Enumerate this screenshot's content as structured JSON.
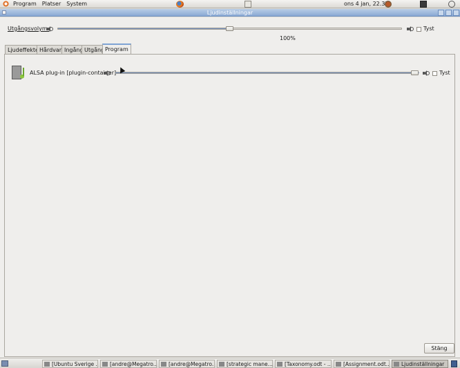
{
  "top_panel": {
    "menus": [
      "Program",
      "Platser",
      "System"
    ],
    "clock": "ons  4 jan, 22.37"
  },
  "window": {
    "title": "Ljudinställningar"
  },
  "output": {
    "label": "Utgångsvolym:",
    "volume_value": 0.5,
    "percent_label": "100%",
    "mute_label": "Tyst"
  },
  "tabs": [
    {
      "label": "Ljudeffekter",
      "active": false
    },
    {
      "label": "Hårdvara",
      "active": false
    },
    {
      "label": "Ingång",
      "active": false
    },
    {
      "label": "Utgång",
      "active": false
    },
    {
      "label": "Program",
      "active": true
    }
  ],
  "applications": [
    {
      "name": "ALSA plug-in [plugin-container]",
      "volume_value": 1.0,
      "mute_label": "Tyst",
      "icon": "music-film-icon"
    }
  ],
  "dialog": {
    "close_label": "Stäng"
  },
  "taskbar": {
    "tasks": [
      {
        "label": "[Ubuntu Sverige ...",
        "active": false
      },
      {
        "label": "[andre@Megatro...",
        "active": false
      },
      {
        "label": "[andre@Megatro...",
        "active": false
      },
      {
        "label": "[strategic mane...",
        "active": false
      },
      {
        "label": "[Taxonomy.odt - ...",
        "active": false
      },
      {
        "label": "[Assignment.odt...",
        "active": false
      },
      {
        "label": "Ljudinställningar",
        "active": true
      }
    ]
  },
  "colors": {
    "accent": "#7693c2",
    "titlebar": "#8aa9d4"
  }
}
